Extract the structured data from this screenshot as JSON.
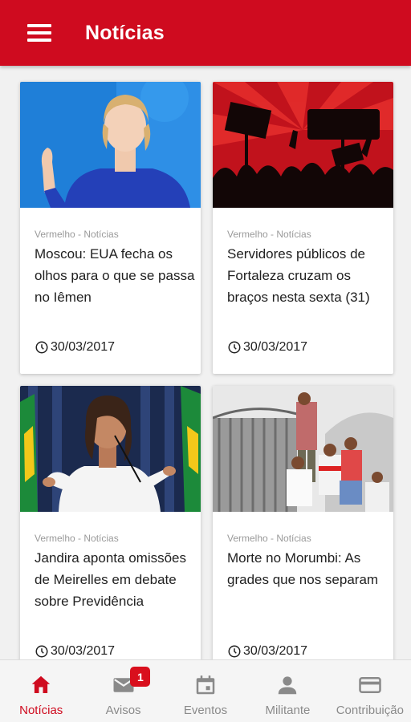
{
  "appbar": {
    "title": "Notícias",
    "color": "#cf0b1f"
  },
  "news": [
    {
      "source": "Vermelho - Notícias",
      "title": "Moscou: EUA fecha os olhos para o que se passa no Iêmen",
      "date": "30/03/2017"
    },
    {
      "source": "Vermelho - Notícias",
      "title": "Servidores públicos de Fortaleza cruzam os braços nesta sexta (31)",
      "date": "30/03/2017"
    },
    {
      "source": "Vermelho - Notícias",
      "title": "Jandira aponta omissões de Meirelles em debate sobre Previdência",
      "date": "30/03/2017"
    },
    {
      "source": "Vermelho - Notícias",
      "title": "Morte no Morumbi: As grades que nos separam",
      "date": "30/03/2017"
    }
  ],
  "bottom_nav": {
    "items": [
      {
        "label": "Notícias",
        "icon": "home-icon",
        "active": true
      },
      {
        "label": "Avisos",
        "icon": "mail-icon",
        "badge": "1"
      },
      {
        "label": "Eventos",
        "icon": "calendar-icon"
      },
      {
        "label": "Militante",
        "icon": "person-icon"
      },
      {
        "label": "Contribuição",
        "icon": "credit-card-icon"
      }
    ]
  }
}
